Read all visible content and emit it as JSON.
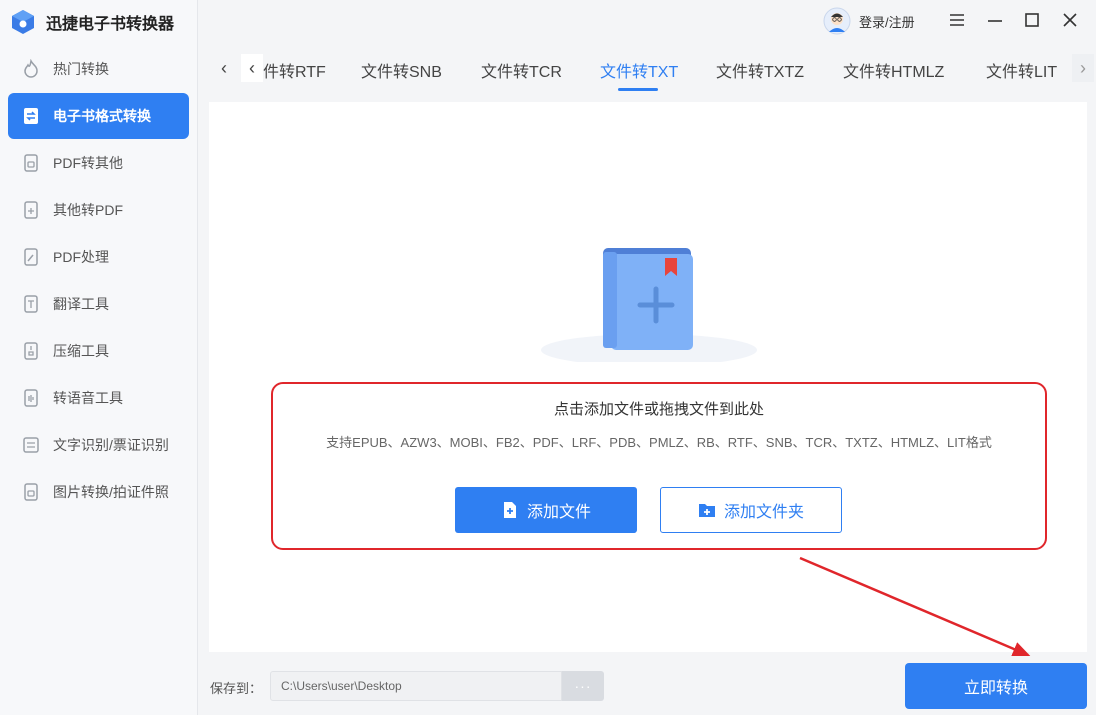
{
  "app": {
    "title": "迅捷电子书转换器"
  },
  "sidebar": {
    "items": [
      {
        "label": "热门转换",
        "icon": "fire-icon",
        "active": false
      },
      {
        "label": "电子书格式转换",
        "icon": "ebook-convert-icon",
        "active": true
      },
      {
        "label": "PDF转其他",
        "icon": "pdf-to-other-icon",
        "active": false
      },
      {
        "label": "其他转PDF",
        "icon": "other-to-pdf-icon",
        "active": false
      },
      {
        "label": "PDF处理",
        "icon": "pdf-edit-icon",
        "active": false
      },
      {
        "label": "翻译工具",
        "icon": "translate-icon",
        "active": false
      },
      {
        "label": "压缩工具",
        "icon": "compress-icon",
        "active": false
      },
      {
        "label": "转语音工具",
        "icon": "speech-icon",
        "active": false
      },
      {
        "label": "文字识别/票证识别",
        "icon": "ocr-icon",
        "active": false
      },
      {
        "label": "图片转换/拍证件照",
        "icon": "image-convert-icon",
        "active": false
      }
    ]
  },
  "header": {
    "user_label": "登录/注册"
  },
  "tabs": {
    "items": [
      "件转RTF",
      "文件转SNB",
      "文件转TCR",
      "文件转TXT",
      "文件转TXTZ",
      "文件转HTMLZ",
      "文件转LIT"
    ],
    "active": "文件转TXT"
  },
  "dropzone": {
    "title": "点击添加文件或拖拽文件到此处",
    "formats": "支持EPUB、AZW3、MOBI、FB2、PDF、LRF、PDB、PMLZ、RB、RTF、SNB、TCR、TXTZ、HTMLZ、LIT格式",
    "add_file_label": "添加文件",
    "add_folder_label": "添加文件夹"
  },
  "bottom": {
    "save_label": "保存到：",
    "save_path": "C:\\Users\\user\\Desktop",
    "browse_label": "···",
    "convert_label": "立即转换"
  },
  "colors": {
    "accent": "#2f7ff2",
    "highlight": "#e0262b"
  }
}
